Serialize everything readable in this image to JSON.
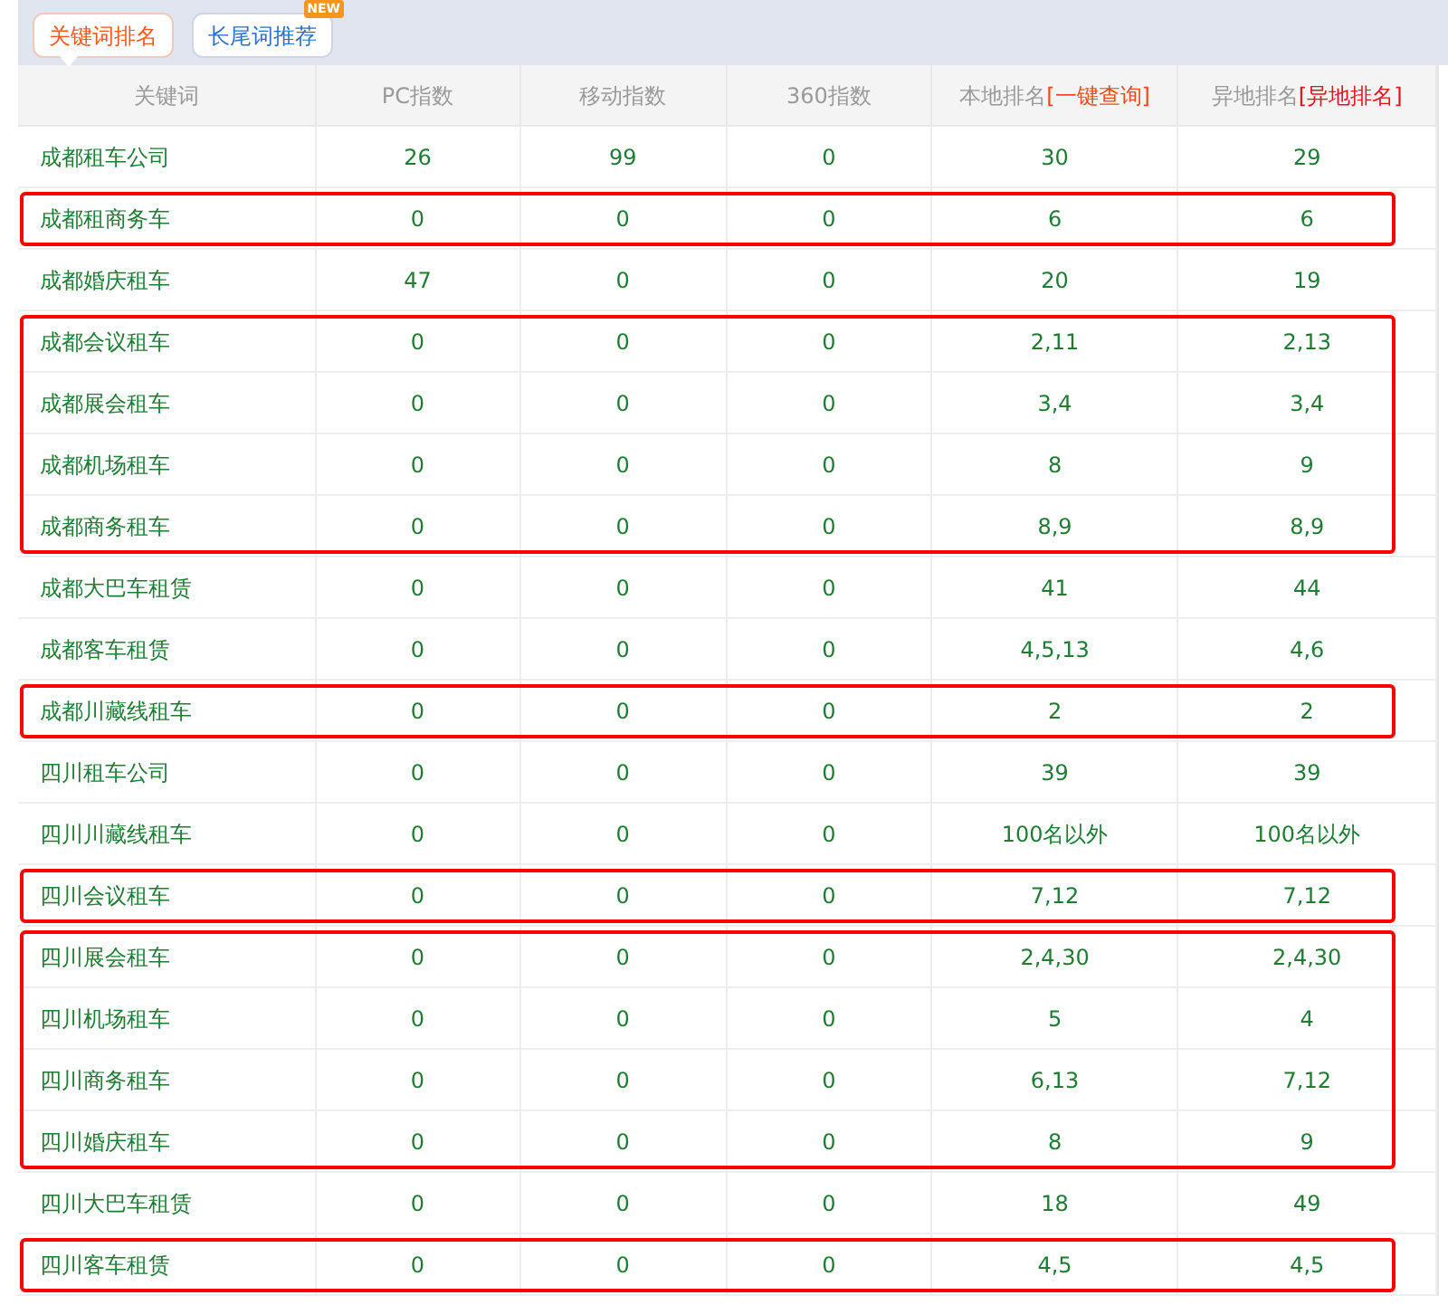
{
  "tabs": [
    {
      "label": "关键词排名",
      "selected": true
    },
    {
      "label": "长尾词推荐",
      "selected": false,
      "badge": "NEW"
    }
  ],
  "table": {
    "columns": [
      {
        "label": "关键词"
      },
      {
        "label": "PC指数"
      },
      {
        "label": "移动指数"
      },
      {
        "label": "360指数"
      },
      {
        "label": "本地排名",
        "link": "[一键查询]"
      },
      {
        "label": "异地排名",
        "link": "[异地排名]"
      }
    ],
    "row_groups": [
      {
        "boxed": false,
        "rows": [
          [
            "成都租车公司",
            "26",
            "99",
            "0",
            "30",
            "29"
          ]
        ]
      },
      {
        "boxed": true,
        "rows": [
          [
            "成都租商务车",
            "0",
            "0",
            "0",
            "6",
            "6"
          ]
        ]
      },
      {
        "boxed": false,
        "rows": [
          [
            "成都婚庆租车",
            "47",
            "0",
            "0",
            "20",
            "19"
          ]
        ]
      },
      {
        "boxed": true,
        "rows": [
          [
            "成都会议租车",
            "0",
            "0",
            "0",
            "2,11",
            "2,13"
          ],
          [
            "成都展会租车",
            "0",
            "0",
            "0",
            "3,4",
            "3,4"
          ],
          [
            "成都机场租车",
            "0",
            "0",
            "0",
            "8",
            "9"
          ],
          [
            "成都商务租车",
            "0",
            "0",
            "0",
            "8,9",
            "8,9"
          ]
        ]
      },
      {
        "boxed": false,
        "rows": [
          [
            "成都大巴车租赁",
            "0",
            "0",
            "0",
            "41",
            "44"
          ],
          [
            "成都客车租赁",
            "0",
            "0",
            "0",
            "4,5,13",
            "4,6"
          ]
        ]
      },
      {
        "boxed": true,
        "rows": [
          [
            "成都川藏线租车",
            "0",
            "0",
            "0",
            "2",
            "2"
          ]
        ]
      },
      {
        "boxed": false,
        "rows": [
          [
            "四川租车公司",
            "0",
            "0",
            "0",
            "39",
            "39"
          ],
          [
            "四川川藏线租车",
            "0",
            "0",
            "0",
            "100名以外",
            "100名以外"
          ]
        ]
      },
      {
        "boxed": true,
        "rows": [
          [
            "四川会议租车",
            "0",
            "0",
            "0",
            "7,12",
            "7,12"
          ]
        ]
      },
      {
        "boxed": true,
        "rows": [
          [
            "四川展会租车",
            "0",
            "0",
            "0",
            "2,4,30",
            "2,4,30"
          ],
          [
            "四川机场租车",
            "0",
            "0",
            "0",
            "5",
            "4"
          ],
          [
            "四川商务租车",
            "0",
            "0",
            "0",
            "6,13",
            "7,12"
          ],
          [
            "四川婚庆租车",
            "0",
            "0",
            "0",
            "8",
            "9"
          ]
        ]
      },
      {
        "boxed": false,
        "rows": [
          [
            "四川大巴车租赁",
            "0",
            "0",
            "0",
            "18",
            "49"
          ]
        ]
      },
      {
        "boxed": true,
        "rows": [
          [
            "四川客车租赁",
            "0",
            "0",
            "0",
            "4,5",
            "4,5"
          ]
        ]
      }
    ]
  }
}
